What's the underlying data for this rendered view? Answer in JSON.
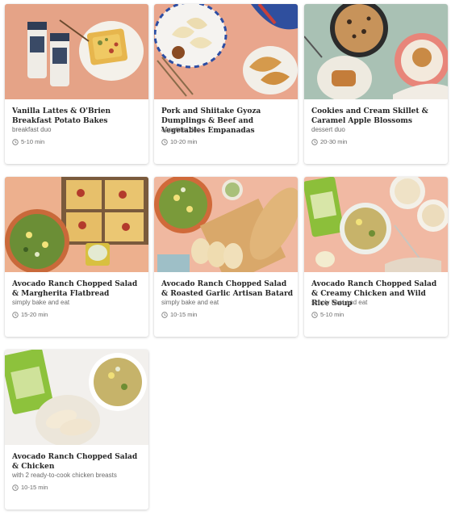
{
  "cards": [
    {
      "title": "Vanilla Lattes & O'Brien Breakfast Potato Bakes",
      "subtitle": "breakfast duo",
      "time": "5-10 min",
      "image": "breakfast-photo"
    },
    {
      "title": "Pork and Shiitake Gyoza Dumplings & Beef and Vegetables Empanadas",
      "subtitle": "appetizer duo",
      "time": "10-20 min",
      "image": "appetizer-photo"
    },
    {
      "title": "Cookies and Cream Skillet & Caramel Apple Blossoms",
      "subtitle": "dessert duo",
      "time": "20-30 min",
      "image": "dessert-photo"
    },
    {
      "title": "Avocado Ranch Chopped Salad & Margherita Flatbread",
      "subtitle": "simply bake and eat",
      "time": "15-20 min",
      "image": "salad-flatbread-photo"
    },
    {
      "title": "Avocado Ranch Chopped Salad & Roasted Garlic Artisan Batard",
      "subtitle": "simply bake and eat",
      "time": "10-15 min",
      "image": "salad-bread-photo"
    },
    {
      "title": "Avocado Ranch Chopped Salad & Creamy Chicken and Wild Rice Soup",
      "subtitle": "simply heat and eat",
      "time": "5-10 min",
      "image": "salad-soup-photo"
    },
    {
      "title": "Avocado Ranch Chopped Salad & Chicken",
      "subtitle": "with 2 ready-to-cook chicken breasts",
      "time": "10-15 min",
      "image": "salad-chicken-photo"
    }
  ],
  "icons": {
    "time": "clock-icon"
  }
}
